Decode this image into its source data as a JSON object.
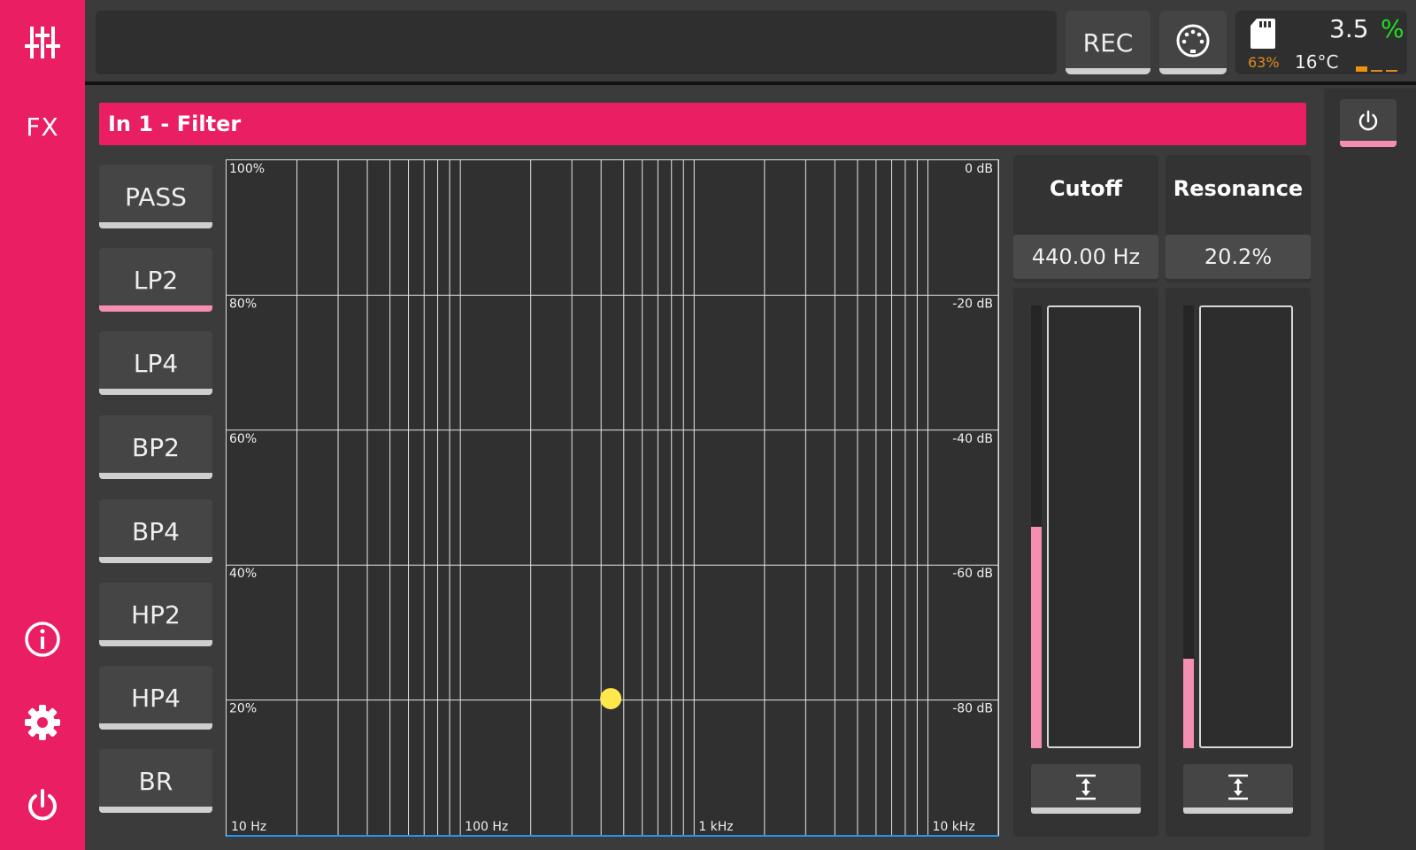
{
  "sidebar": {
    "mixer_icon": "mixer-sliders-icon",
    "fx_label": "FX",
    "info_icon": "info-icon",
    "settings_icon": "gear-icon",
    "power_icon": "power-icon"
  },
  "topbar": {
    "title": "",
    "rec_label": "REC",
    "midi_icon": "midi-din-icon",
    "status": {
      "sd_icon": "sd-card-icon",
      "sd_percent": "63%",
      "cpu_value": "3.5",
      "cpu_unit": "%",
      "temperature": "16°C",
      "temp_level": 1,
      "temp_levels_total": 3
    }
  },
  "right_panel": {
    "power_toggle_icon": "power-icon",
    "power_active": true
  },
  "panel": {
    "title": "In 1 - Filter",
    "filter_types": [
      {
        "label": "PASS",
        "active": false
      },
      {
        "label": "LP2",
        "active": true
      },
      {
        "label": "LP4",
        "active": false
      },
      {
        "label": "BP2",
        "active": false
      },
      {
        "label": "BP4",
        "active": false
      },
      {
        "label": "HP2",
        "active": false
      },
      {
        "label": "HP4",
        "active": false
      },
      {
        "label": "BR",
        "active": false
      }
    ]
  },
  "graph": {
    "left_axis_labels": [
      "100%",
      "80%",
      "60%",
      "40%",
      "20%"
    ],
    "right_axis_labels": [
      "0 dB",
      "-20 dB",
      "-40 dB",
      "-60 dB",
      "-80 dB"
    ],
    "x_axis_labels": [
      "10 Hz",
      "100 Hz",
      "1 kHz",
      "10 kHz"
    ],
    "x_range_hz": [
      10,
      20000
    ],
    "y_range_percent": [
      0,
      100
    ],
    "point": {
      "frequency_hz": 440,
      "resonance_percent": 20.2,
      "color": "#ffe74c"
    }
  },
  "params": {
    "cutoff": {
      "title": "Cutoff",
      "value": "440.00 Hz",
      "level": 0.5,
      "reset_icon": "reset-to-default-icon"
    },
    "resonance": {
      "title": "Resonance",
      "value": "20.2%",
      "level": 0.202,
      "reset_icon": "reset-to-default-icon"
    }
  },
  "colors": {
    "accent": "#e91e63",
    "accent_light": "#f48fb1",
    "cpu_ok": "#22dd22",
    "sd_warning": "#e08a1e",
    "point": "#ffe74c",
    "axis_line": "#2196f3"
  }
}
